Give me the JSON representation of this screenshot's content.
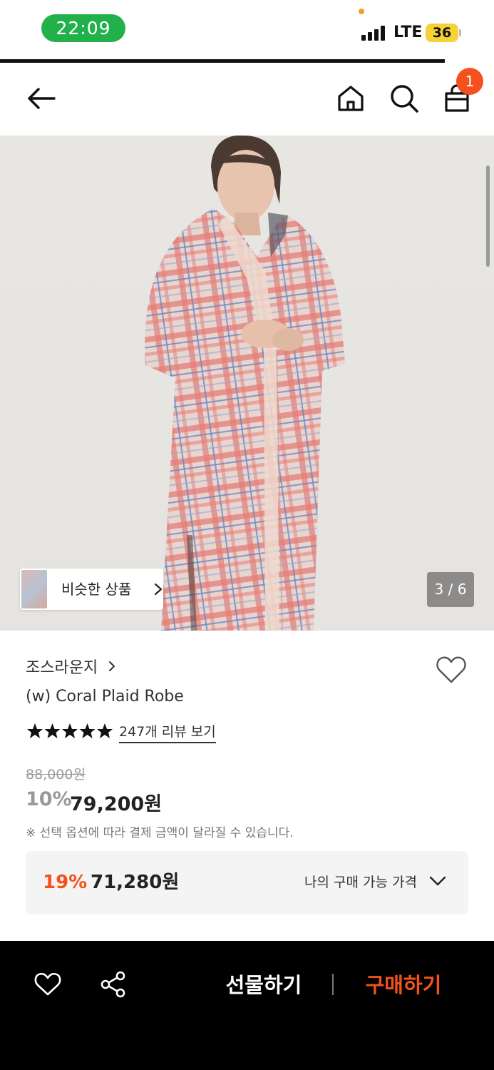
{
  "status_bar": {
    "time": "22:09",
    "network": "LTE",
    "battery": "36"
  },
  "header": {
    "cart_count": "1",
    "icons": [
      "back-arrow-icon",
      "home-icon",
      "search-icon",
      "shopping-bag-icon"
    ]
  },
  "gallery": {
    "similar_label": "비슷한 상품",
    "counter": "3 / 6",
    "current_index": 3,
    "total": 6
  },
  "product": {
    "brand": "조스라운지",
    "name": "(w) Coral Plaid Robe",
    "rating_stars": 5,
    "reviews_label": "247개 리뷰 보기",
    "original_price": "88,000원",
    "discount": "10%",
    "price": "79,200원",
    "notice": "※ 선택 옵션에 따라 결제 금액이 달라질 수 있습니다."
  },
  "my_price": {
    "discount": "19%",
    "price": "71,280원",
    "label": "나의 구매 가능 가격"
  },
  "bottom_bar": {
    "gift_label": "선물하기",
    "buy_label": "구매하기"
  },
  "colors": {
    "accent": "#f4511e",
    "status_green": "#22b04b",
    "bottom_bar_bg": "#000000"
  }
}
